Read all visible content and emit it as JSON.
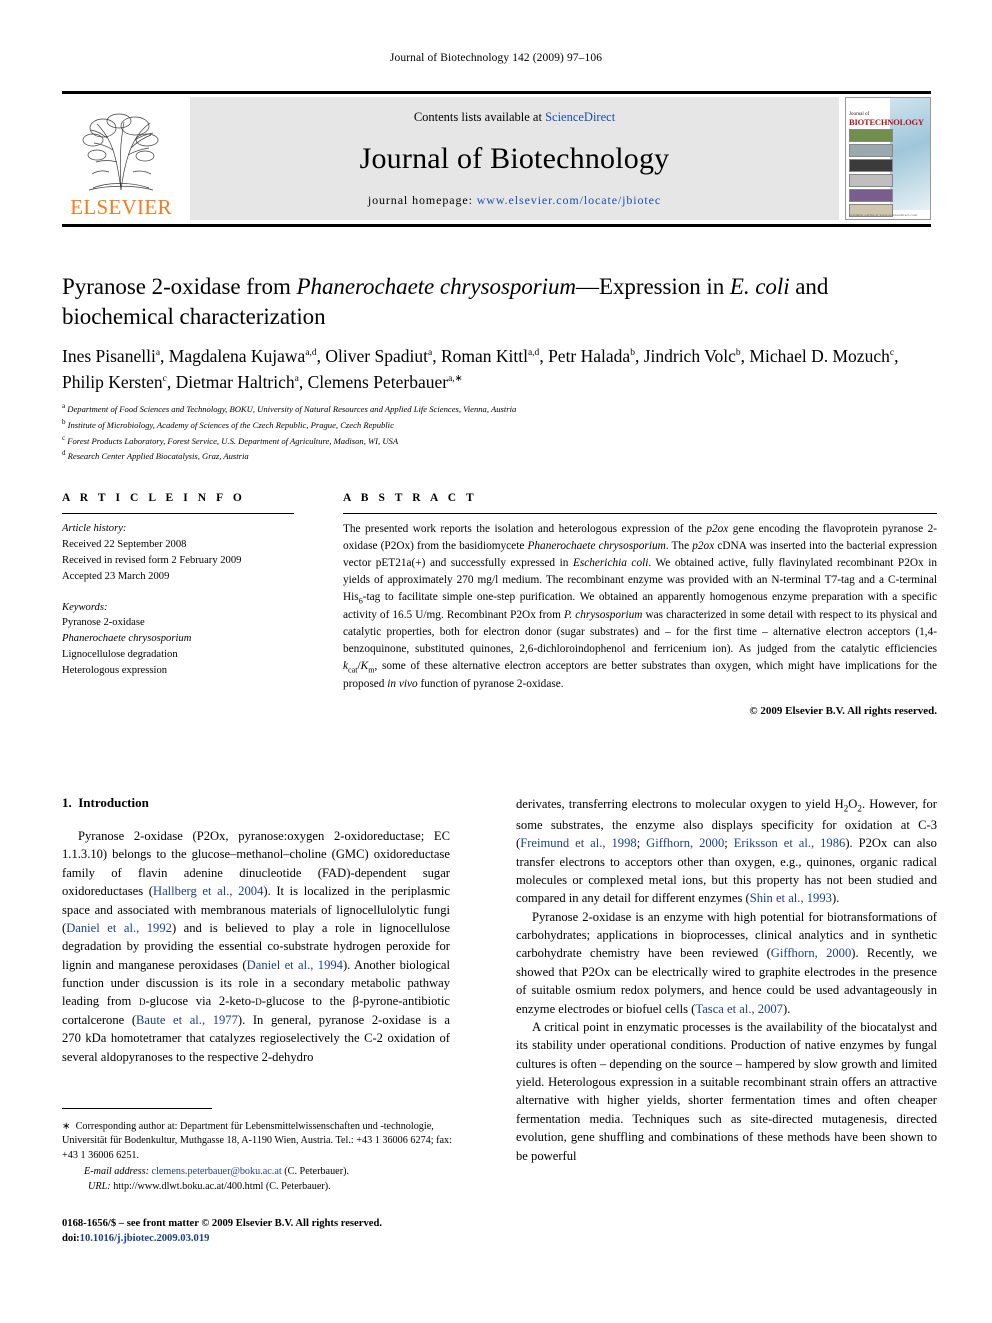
{
  "running_head": "Journal of Biotechnology 142 (2009) 97–106",
  "masthead": {
    "contents_prefix": "Contents lists available at ",
    "sciencedirect": "ScienceDirect",
    "journal_title": "Journal of Biotechnology",
    "homepage_label": "journal homepage: ",
    "homepage_url": "www.elsevier.com/locate/jbiotec",
    "publisher": "ELSEVIER",
    "publisher_color": "#F47B20",
    "link_color": "#1a4ea8",
    "cover": {
      "small_label": "Journal of",
      "big_label": "BIOTECHNOLOGY",
      "footer_label": "available online at www.sciencedirect.com"
    }
  },
  "article": {
    "title_part1": "Pyranose 2-oxidase from ",
    "title_italic1": "Phanerochaete chrysosporium",
    "title_part2": "—Expression in ",
    "title_italic2": "E. coli",
    "title_part3": " and biochemical characterization",
    "authors": [
      {
        "name": "Ines Pisanelli",
        "marks": "a"
      },
      {
        "name": "Magdalena Kujawa",
        "marks": "a,d"
      },
      {
        "name": "Oliver Spadiut",
        "marks": "a"
      },
      {
        "name": "Roman Kittl",
        "marks": "a,d"
      },
      {
        "name": "Petr Halada",
        "marks": "b"
      },
      {
        "name": "Jindrich Volc",
        "marks": "b"
      },
      {
        "name": "Michael D. Mozuch",
        "marks": "c"
      },
      {
        "name": "Philip Kersten",
        "marks": "c"
      },
      {
        "name": "Dietmar Haltrich",
        "marks": "a"
      },
      {
        "name": "Clemens Peterbauer",
        "marks": "a,∗"
      }
    ],
    "affiliations": [
      {
        "mark": "a",
        "text": "Department of Food Sciences and Technology, BOKU, University of Natural Resources and Applied Life Sciences, Vienna, Austria"
      },
      {
        "mark": "b",
        "text": "Institute of Microbiology, Academy of Sciences of the Czech Republic, Prague, Czech Republic"
      },
      {
        "mark": "c",
        "text": "Forest Products Laboratory, Forest Service, U.S. Department of Agriculture, Madison, WI, USA"
      },
      {
        "mark": "d",
        "text": "Research Center Applied Biocatalysis, Graz, Austria"
      }
    ]
  },
  "article_info": {
    "heading": "A R T I C L E   I N F O",
    "history_label": "Article history:",
    "history": [
      "Received 22 September 2008",
      "Received in revised form 2 February 2009",
      "Accepted 23 March 2009"
    ],
    "keywords_label": "Keywords:",
    "keywords": [
      {
        "text": "Pyranose 2-oxidase",
        "italic": false
      },
      {
        "text": "Phanerochaete chrysosporium",
        "italic": true
      },
      {
        "text": "Lignocellulose degradation",
        "italic": false
      },
      {
        "text": "Heterologous expression",
        "italic": false
      }
    ]
  },
  "abstract": {
    "heading": "A B S T R A C T",
    "copyright": "© 2009 Elsevier B.V. All rights reserved."
  },
  "introduction": {
    "number": "1.",
    "heading": "Introduction"
  },
  "footnote": {
    "corresponding": "Corresponding author at: Department für Lebensmittelwissenschaften und -technologie, Universität für Bodenkultur, Muthgasse 18, A-1190 Wien, Austria. Tel.: +43 1 36006 6274; fax: +43 1 36006 6251.",
    "email_label": "E-mail address:",
    "email": "clemens.peterbauer@boku.ac.at",
    "email_attrib": "(C. Peterbauer).",
    "url_label": "URL:",
    "url": "http://www.dlwt.boku.ac.at/400.html",
    "url_attrib": "(C. Peterbauer).",
    "issn_line": "0168-1656/$ – see front matter © 2009 Elsevier B.V. All rights reserved.",
    "doi_label": "doi:",
    "doi": "10.1016/j.jbiotec.2009.03.019"
  }
}
